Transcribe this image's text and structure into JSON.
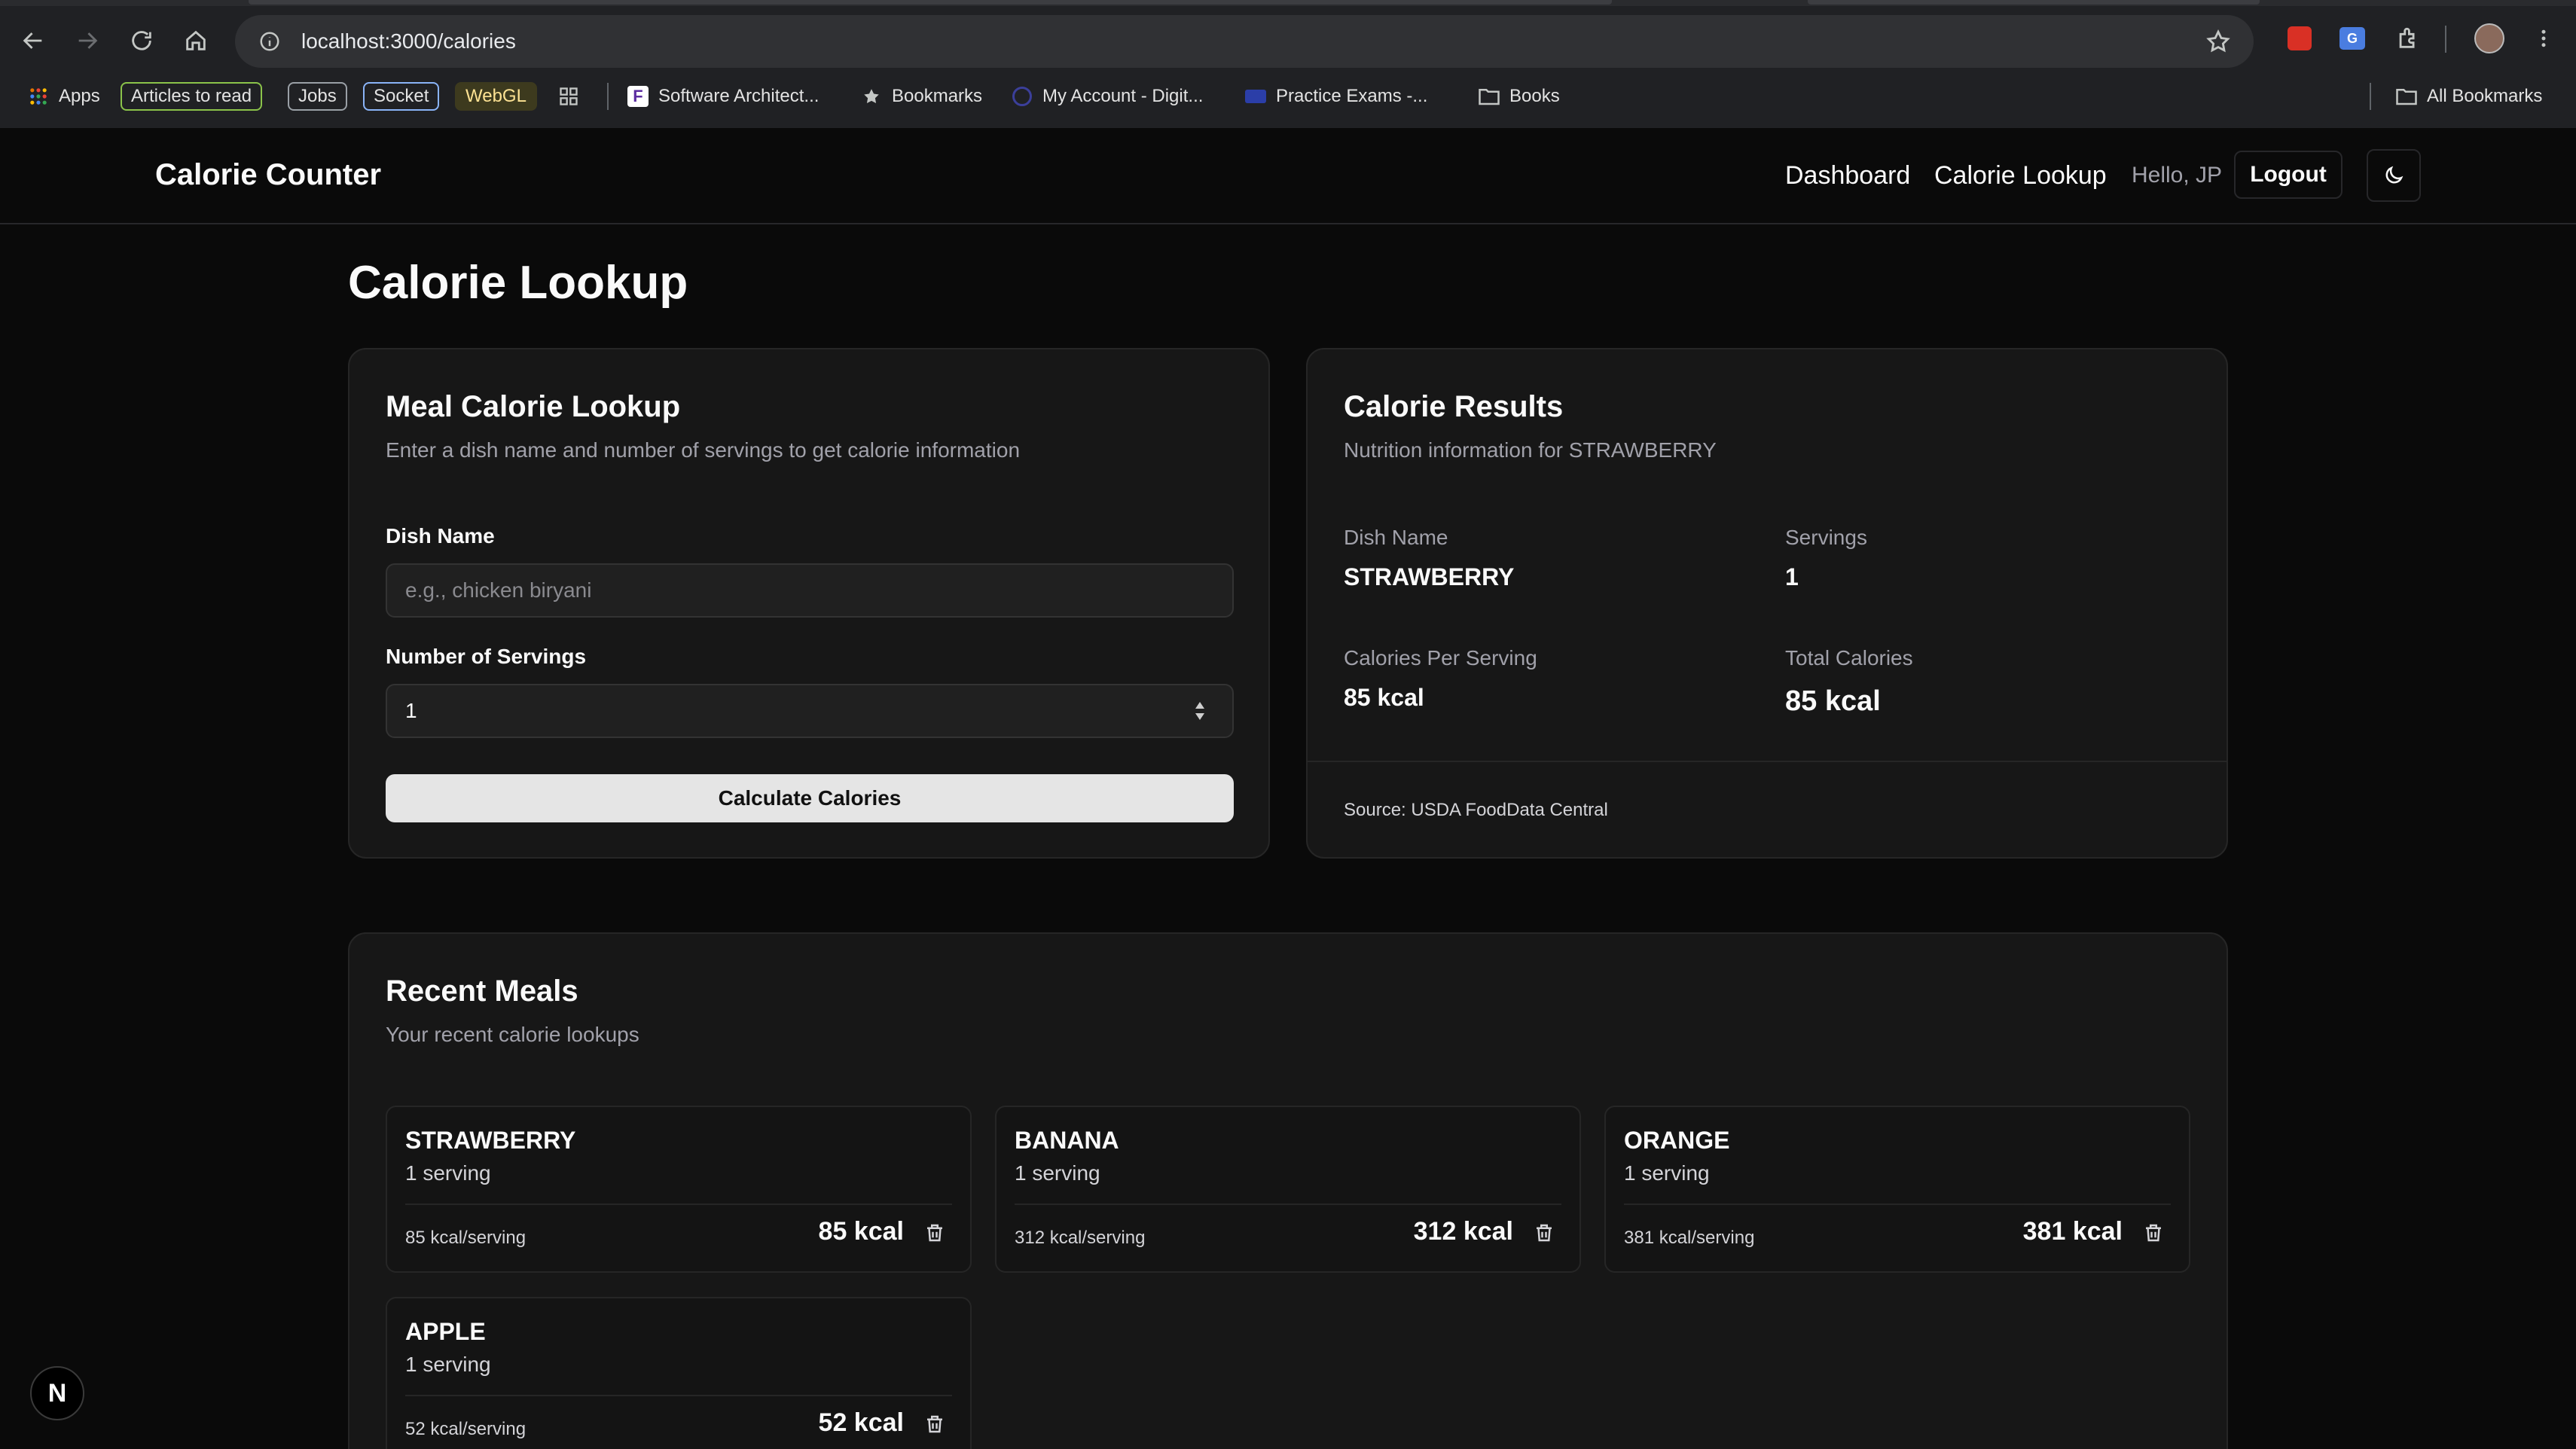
{
  "browser": {
    "url": "localhost:3000/calories",
    "bookmarks": {
      "apps": "Apps",
      "articles": "Articles to read",
      "jobs": "Jobs",
      "socket": "Socket",
      "webgl": "WebGL",
      "software": "Software Architect...",
      "bookmarks": "Bookmarks",
      "account": "My Account - Digit...",
      "practice": "Practice Exams -...",
      "books": "Books",
      "all": "All Bookmarks"
    }
  },
  "nav": {
    "brand": "Calorie Counter",
    "dashboard": "Dashboard",
    "lookup": "Calorie Lookup",
    "greeting": "Hello, JP",
    "logout": "Logout"
  },
  "page": {
    "title": "Calorie Lookup"
  },
  "lookup_form": {
    "title": "Meal Calorie Lookup",
    "description": "Enter a dish name and number of servings to get calorie information",
    "dish_label": "Dish Name",
    "dish_placeholder": "e.g., chicken biryani",
    "dish_value": "",
    "servings_label": "Number of Servings",
    "servings_value": "1",
    "submit": "Calculate Calories"
  },
  "results": {
    "title": "Calorie Results",
    "description": "Nutrition information for STRAWBERRY",
    "dish_label": "Dish Name",
    "dish_value": "STRAWBERRY",
    "servings_label": "Servings",
    "servings_value": "1",
    "per_label": "Calories Per Serving",
    "per_value": "85 kcal",
    "total_label": "Total Calories",
    "total_value": "85 kcal",
    "source": "Source: USDA FoodData Central"
  },
  "recent": {
    "title": "Recent Meals",
    "description": "Your recent calorie lookups",
    "meals": [
      {
        "name": "STRAWBERRY",
        "servings": "1 serving",
        "per": "85 kcal/serving",
        "total": "85 kcal"
      },
      {
        "name": "BANANA",
        "servings": "1 serving",
        "per": "312 kcal/serving",
        "total": "312 kcal"
      },
      {
        "name": "ORANGE",
        "servings": "1 serving",
        "per": "381 kcal/serving",
        "total": "381 kcal"
      },
      {
        "name": "APPLE",
        "servings": "1 serving",
        "per": "52 kcal/serving",
        "total": "52 kcal"
      }
    ]
  },
  "next_badge": "N"
}
